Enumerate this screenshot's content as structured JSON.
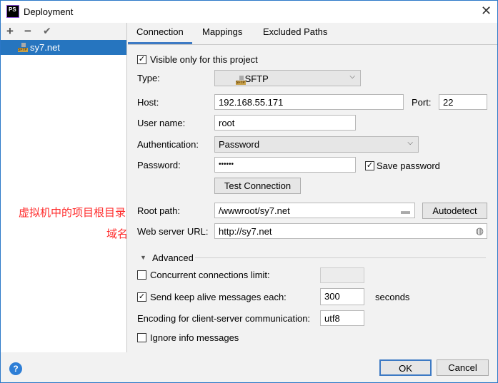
{
  "window": {
    "title": "Deployment",
    "logo_text": "PS",
    "close_icon": "close-icon"
  },
  "sidebar": {
    "add": "+",
    "remove": "−",
    "apply": "✔",
    "servers": [
      {
        "name": "sy7.net",
        "icon": "sftp-icon",
        "selected": true
      }
    ]
  },
  "tabs": [
    {
      "label": "Connection",
      "active": true
    },
    {
      "label": "Mappings"
    },
    {
      "label": "Excluded Paths"
    }
  ],
  "form": {
    "visible_only": {
      "label": "Visible only for this project",
      "checked": true
    },
    "type": {
      "label": "Type:",
      "value": "SFTP"
    },
    "host": {
      "label": "Host:",
      "value": "192.168.55.171"
    },
    "port": {
      "label": "Port:",
      "value": "22"
    },
    "username": {
      "label": "User name:",
      "value": "root"
    },
    "auth": {
      "label": "Authentication:",
      "value": "Password"
    },
    "password": {
      "label": "Password:",
      "value": "••••••"
    },
    "save_password": {
      "label": "Save password",
      "checked": true
    },
    "test_connection": "Test Connection",
    "root_path": {
      "label": "Root path:",
      "value": "/wwwroot/sy7.net"
    },
    "autodetect": "Autodetect",
    "web_url": {
      "label": "Web server URL:",
      "value": "http://sy7.net"
    }
  },
  "advanced": {
    "title": "Advanced",
    "concurrent": {
      "label": "Concurrent connections limit:",
      "checked": false,
      "value": ""
    },
    "keep_alive": {
      "label": "Send keep alive messages each:",
      "checked": true,
      "value": "300",
      "unit": "seconds"
    },
    "encoding": {
      "label": "Encoding for client-server communication:",
      "value": "utf8"
    },
    "ignore_info": {
      "label": "Ignore info messages",
      "checked": false
    }
  },
  "annotations": {
    "root": "虚拟机中的项目根目录",
    "domain": "域名"
  },
  "footer": {
    "help": "?",
    "ok": "OK",
    "cancel": "Cancel"
  },
  "colors": {
    "selection": "#2675bf",
    "annotation": "#ff2a2a",
    "border": "#2b78c8"
  }
}
